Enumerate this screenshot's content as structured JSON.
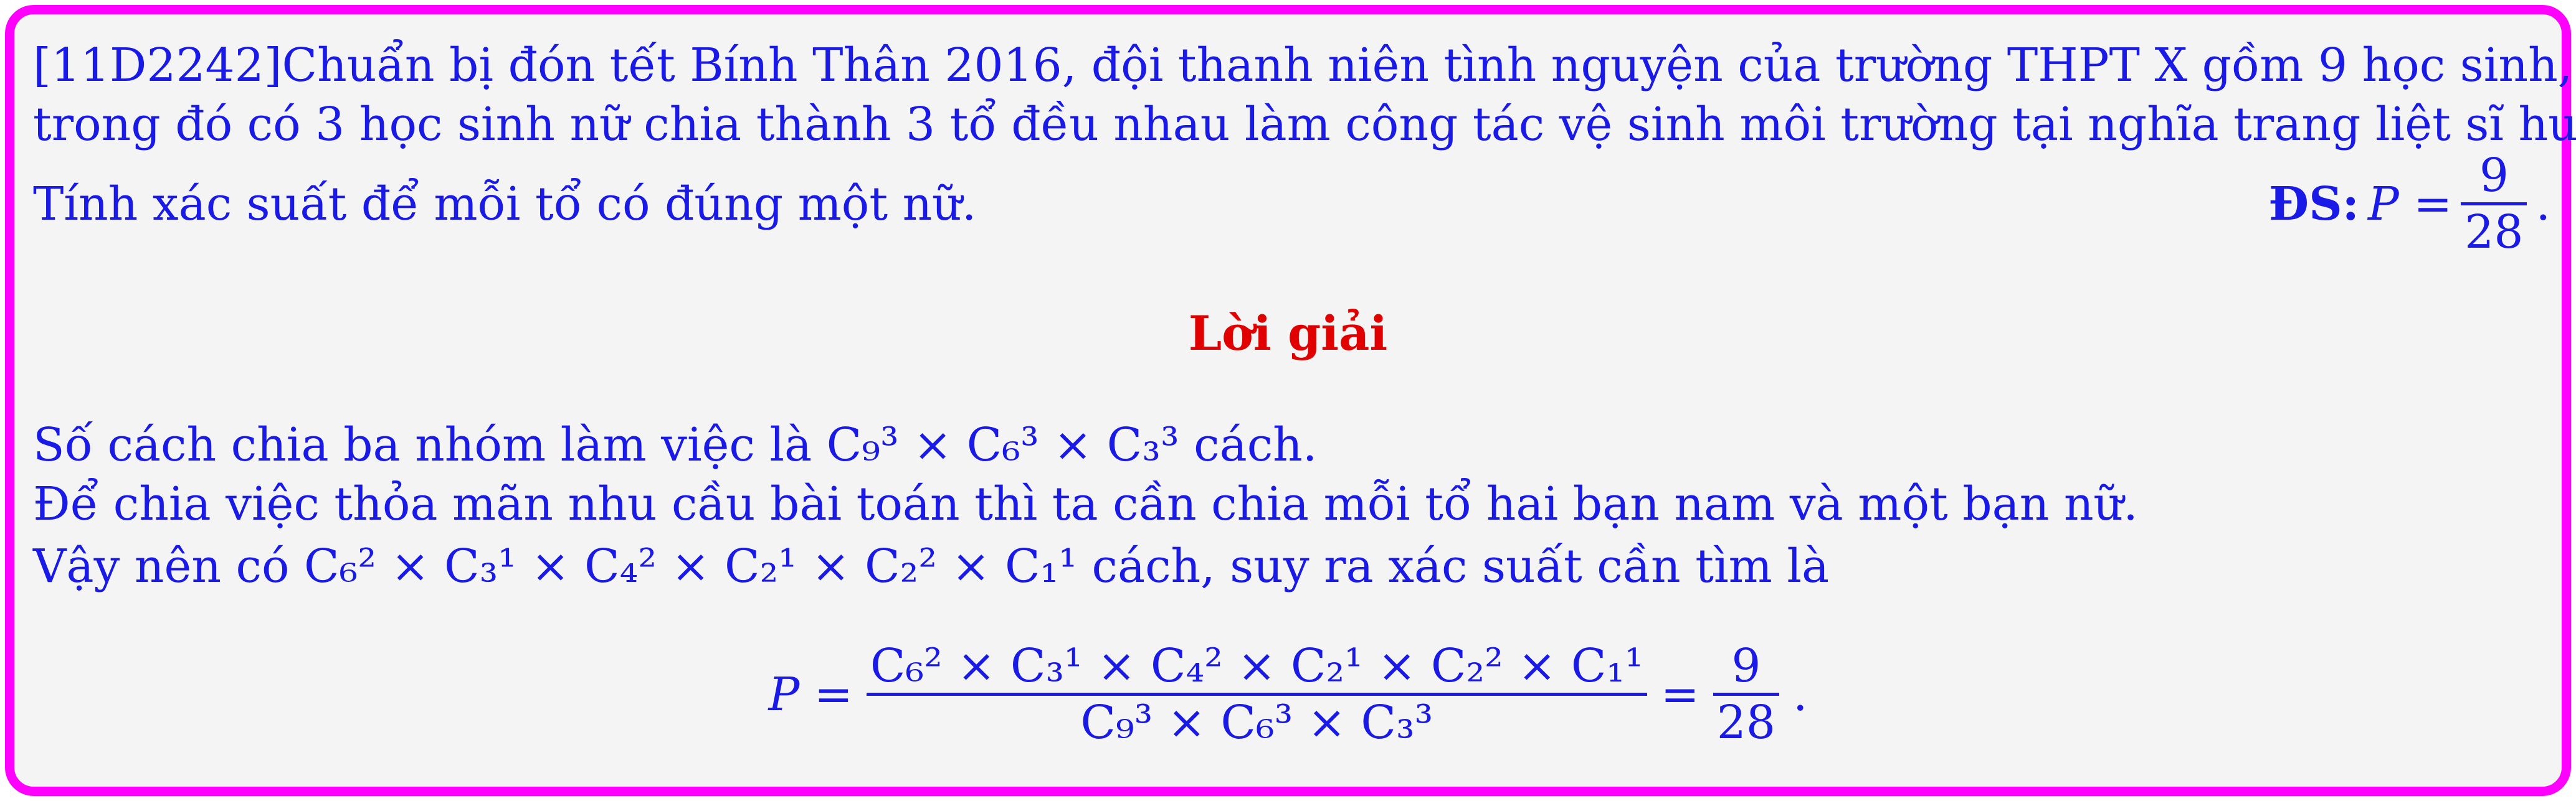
{
  "problem": {
    "line1": "[11D2242]Chuẩn bị đón tết Bính Thân 2016, đội thanh niên tình nguyện của trường THPT X gồm 9 học sinh,",
    "line2": "trong đó có 3 học sinh nữ chia thành 3 tổ đều nhau làm công tác vệ sinh môi trường tại nghĩa trang liệt sĩ huyện.",
    "line3": "Tính xác suất để mỗi tổ có đúng một nữ."
  },
  "answer": {
    "label": "ĐS:",
    "expr": "P =",
    "numerator": "9",
    "denominator": "28",
    "tail": "."
  },
  "solution": {
    "heading": "Lời giải",
    "line1": "Số cách chia ba nhóm làm việc là C₉³ × C₆³ × C₃³ cách.",
    "line2": "Để chia việc thỏa mãn nhu cầu bài toán thì ta cần chia mỗi tổ hai bạn nam và một bạn nữ.",
    "line3": "Vậy nên có C₆² × C₃¹ × C₄² × C₂¹ × C₂² × C₁¹ cách, suy ra xác suất cần tìm là",
    "formula": {
      "lhs": "P =",
      "numerator": "C₆² × C₃¹ × C₄² × C₂¹ × C₂² × C₁¹",
      "denominator": "C₉³ × C₆³ × C₃³",
      "eq": "=",
      "result_num": "9",
      "result_den": "28",
      "tail": "."
    }
  }
}
